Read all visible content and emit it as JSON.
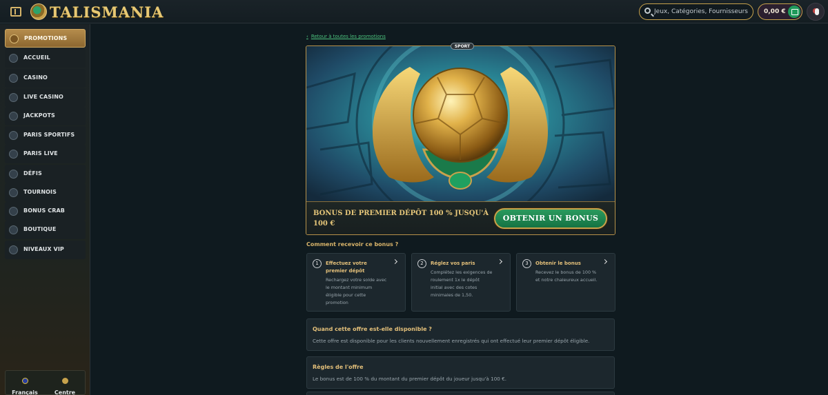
{
  "brand": {
    "name": "TALISMANIA"
  },
  "header": {
    "search_placeholder": "Jeux, Catégories, Fournisseurs",
    "balance": "0,00 €"
  },
  "sidebar": {
    "items": [
      {
        "label": "PROMOTIONS",
        "icon": "gift-icon",
        "active": true
      },
      {
        "label": "ACCUEIL",
        "icon": "home-icon"
      },
      {
        "label": "CASINO",
        "icon": "casino-chip-icon"
      },
      {
        "label": "LIVE CASINO",
        "icon": "live-dealer-icon"
      },
      {
        "label": "JACKPOTS",
        "icon": "clover-icon"
      },
      {
        "label": "PARIS SPORTIFS",
        "icon": "football-icon"
      },
      {
        "label": "PARIS LIVE",
        "icon": "live-tv-icon"
      },
      {
        "label": "DÉFIS",
        "icon": "challenge-icon"
      },
      {
        "label": "TOURNOIS",
        "icon": "trophy-icon"
      },
      {
        "label": "BONUS CRAB",
        "icon": "claw-icon"
      },
      {
        "label": "BOUTIQUE",
        "icon": "shop-icon"
      },
      {
        "label": "NIVEAUX VIP",
        "icon": "diamond-icon"
      }
    ],
    "footer": {
      "language": "Français",
      "help": "Centre d'aide"
    }
  },
  "main": {
    "back_link": "Retour à toutes les promotions",
    "badge": "SPORT",
    "promo_title": "BONUS DE PREMIER DÉPÔT 100 % JUSQU'À 100 €",
    "cta_label": "OBTENIR UN BONUS",
    "how_title": "Comment recevoir ce bonus ?",
    "steps": [
      {
        "num": "1",
        "title": "Effectuez votre premier dépôt",
        "desc": "Rechargez votre solde avec le montant minimum éligible pour cette promotion"
      },
      {
        "num": "2",
        "title": "Réglez vos paris",
        "desc": "Complétez les exigences de roulement 1x le dépôt initial avec des cotes minimales de 1,50."
      },
      {
        "num": "3",
        "title": "Obtenir le bonus",
        "desc": "Recevez le bonus de 100 % et notre chaleureux accueil."
      }
    ],
    "faq": [
      {
        "title": "Quand cette offre est-elle disponible ?",
        "text": "Cette offre est disponible pour les clients nouvellement enregistrés qui ont effectué leur premier dépôt éligible."
      },
      {
        "title": "Règles de l'offre",
        "text": "Le bonus est de 100 % du montant du premier dépôt du joueur jusqu'à 100 €."
      }
    ]
  },
  "colors": {
    "accent_gold": "#d9b46a",
    "cta_green": "#1f8a52",
    "link_green": "#4cc37e"
  }
}
